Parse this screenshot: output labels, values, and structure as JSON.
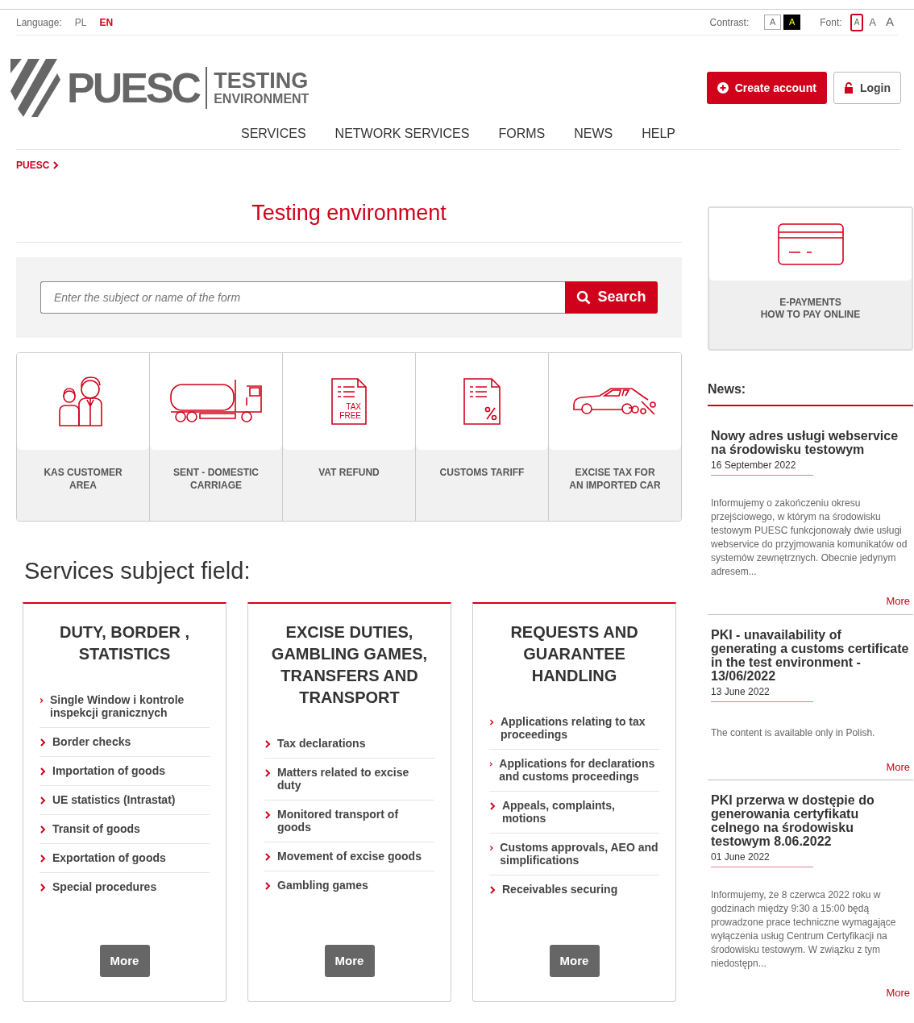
{
  "top_bar": {
    "language_label": "Language:",
    "languages": [
      {
        "label": "PL",
        "selected": false
      },
      {
        "label": "EN",
        "selected": true
      }
    ],
    "contrast_label": "Contrast:",
    "contrast_options": [
      {
        "label": "A",
        "kind": "normal"
      },
      {
        "label": "A",
        "kind": "high"
      }
    ],
    "font_label": "Font:",
    "font_sizes": [
      {
        "label": "A",
        "kind": "small",
        "selected": true
      },
      {
        "label": "A",
        "kind": "medium",
        "selected": false
      },
      {
        "label": "A",
        "kind": "large",
        "selected": false
      }
    ]
  },
  "header": {
    "logo": {
      "name": "PUESC",
      "line1": "TESTING",
      "line2": "ENVIRONMENT"
    },
    "create_account": "Create account",
    "login": "Login"
  },
  "nav": {
    "items": [
      "SERVICES",
      "NETWORK SERVICES",
      "FORMS",
      "NEWS",
      "HELP"
    ]
  },
  "breadcrumb": [
    "PUESC"
  ],
  "page_title": "Testing environment",
  "search": {
    "placeholder": "Enter the subject or name of the form",
    "button": "Search"
  },
  "tiles": [
    {
      "label": "KAS CUSTOMER AREA",
      "kind": "people"
    },
    {
      "label": "SENT - DOMESTIC CARRIAGE",
      "kind": "truck"
    },
    {
      "label": "VAT REFUND",
      "kind": "taxfree",
      "icon_text": [
        "TAX",
        "FREE"
      ]
    },
    {
      "label": "CUSTOMS TARIFF",
      "kind": "tariff"
    },
    {
      "label": "EXCISE TAX FOR AN IMPORTED CAR",
      "kind": "car"
    }
  ],
  "services_heading": "Services subject field:",
  "service_cards": [
    {
      "title": "DUTY, BORDER , STATISTICS",
      "links": [
        "Single Window i kontrole inspekcji granicznych",
        "Border checks",
        "Importation of goods",
        "UE statistics (Intrastat)",
        "Transit of goods",
        "Exportation of goods",
        "Special procedures"
      ],
      "button": "More"
    },
    {
      "title": "EXCISE DUTIES, GAMBLING GAMES, TRANSFERS AND TRANSPORT",
      "links": [
        "Tax declarations",
        "Matters related to excise duty",
        "Monitored transport of goods",
        "Movement of excise goods",
        "Gambling games"
      ],
      "button": "More"
    },
    {
      "title": "REQUESTS AND GUARANTEE HANDLING",
      "links": [
        "Applications relating to tax proceedings",
        "Applications for declarations and customs proceedings",
        "Appeals, complaints, motions",
        "Customs approvals, AEO and simplifications",
        "Receivables securing"
      ],
      "button": "More"
    }
  ],
  "sidebar": {
    "payment_tile": {
      "lines": [
        "E-PAYMENTS",
        "HOW TO PAY ONLINE"
      ]
    },
    "news_heading": "News:",
    "news": [
      {
        "title": "Nowy adres usługi webservice na środowisku testowym",
        "date": "16 September 2022",
        "excerpt": "Informujemy o zakończeniu okresu przejściowego, w którym na środowisku testowym PUESC funkcjonowały dwie usługi webservice do przyjmowania komunikatów od systemów zewnętrznych. Obecnie jedynym adresem...",
        "more": "More"
      },
      {
        "title": "PKI - unavailability of generating a customs certificate in the test environment - 13/06/2022",
        "date": "13 June 2022",
        "excerpt": "The content is available only in Polish.",
        "more": "More"
      },
      {
        "title": "PKI przerwa w dostępie do generowania certyfikatu celnego na środowisku testowym 8.06.2022",
        "date": "01 June 2022",
        "excerpt": "Informujemy, że 8 czerwca 2022 roku w godzinach między 9:30 a 15:00 będą prowadzone prace techniczne wymagające wyłączenia usług Centrum Certyfikacji na środowisku testowym. W związku z tym niedostępn...",
        "more": "More"
      }
    ]
  }
}
